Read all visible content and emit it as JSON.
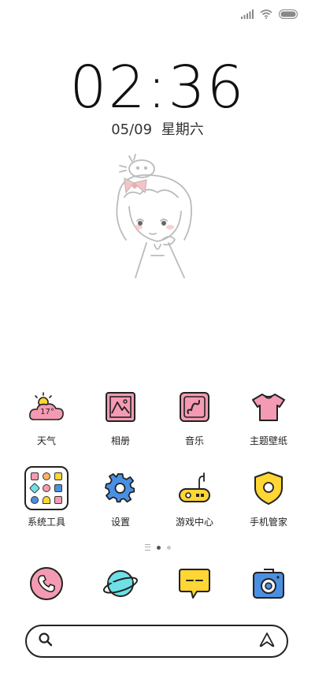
{
  "status": {
    "icons": [
      "signal-icon",
      "wifi-icon",
      "battery-icon"
    ]
  },
  "lockscreen": {
    "time": "02:36",
    "date": "05/09",
    "weekday": "星期六"
  },
  "apps": [
    {
      "label": "天气",
      "icon": "weather-icon",
      "temperature": "17°"
    },
    {
      "label": "相册",
      "icon": "gallery-icon"
    },
    {
      "label": "音乐",
      "icon": "music-icon"
    },
    {
      "label": "主题壁纸",
      "icon": "theme-icon"
    },
    {
      "label": "系统工具",
      "icon": "folder-icon"
    },
    {
      "label": "设置",
      "icon": "settings-icon"
    },
    {
      "label": "游戏中心",
      "icon": "game-center-icon"
    },
    {
      "label": "手机管家",
      "icon": "security-icon"
    }
  ],
  "dock": [
    {
      "icon": "phone-icon"
    },
    {
      "icon": "browser-icon"
    },
    {
      "icon": "messages-icon"
    },
    {
      "icon": "camera-icon"
    }
  ],
  "pages": {
    "count": 2,
    "active": 0
  },
  "colors": {
    "pink": "#f59ab3",
    "blue": "#4a90e2",
    "cyan": "#6fe0e6",
    "yellow": "#ffd633",
    "outline": "#222222"
  }
}
